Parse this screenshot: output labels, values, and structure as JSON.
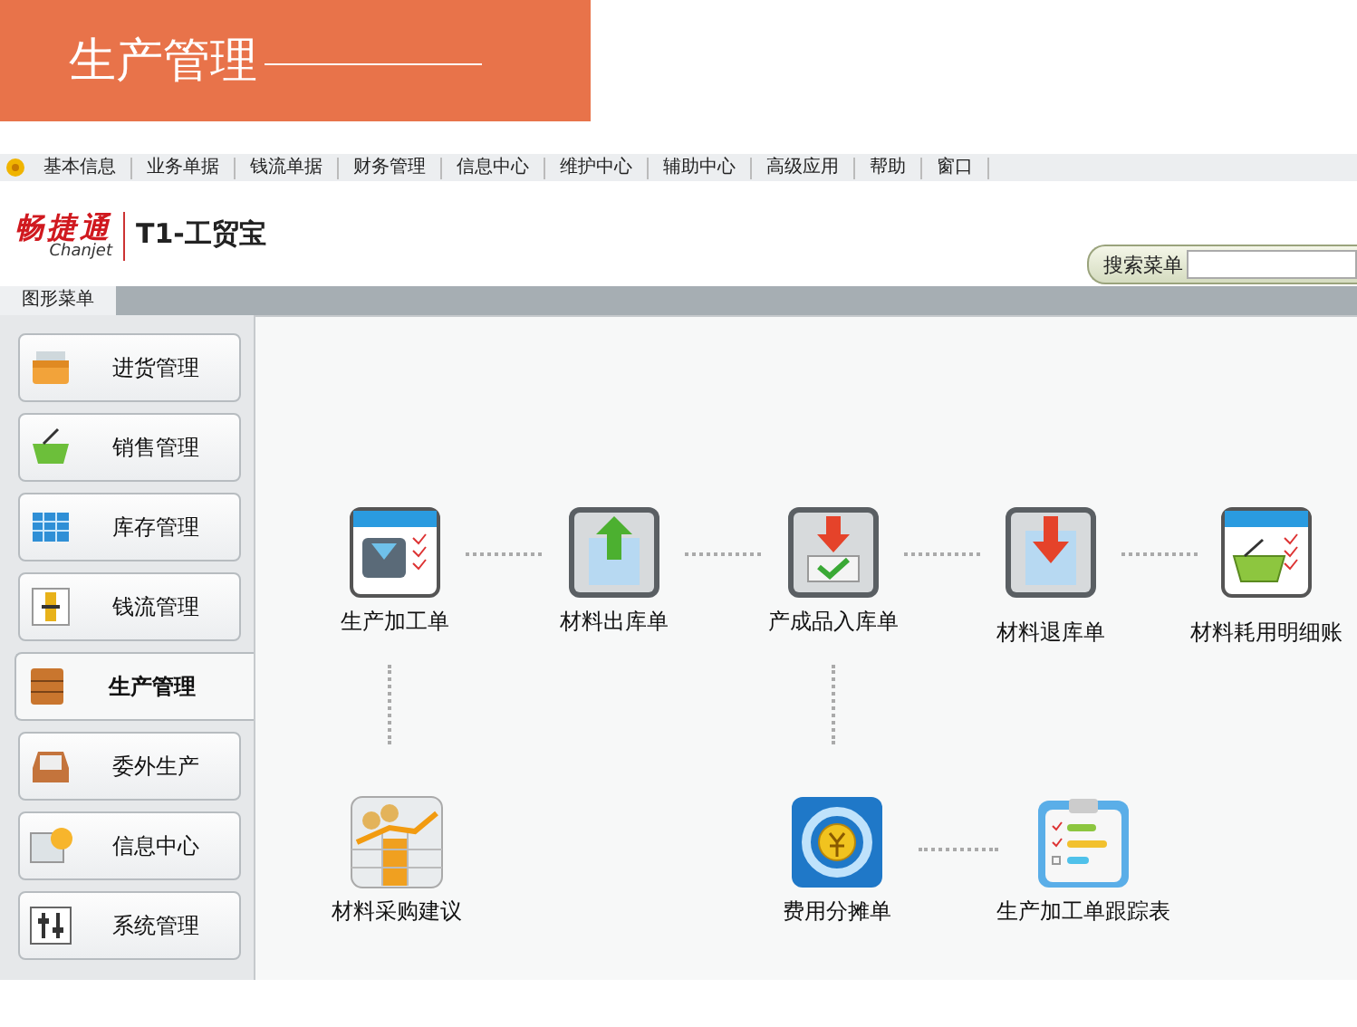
{
  "banner": {
    "title": "生产管理"
  },
  "menu_bar": {
    "items": [
      "基本信息",
      "业务单据",
      "钱流单据",
      "财务管理",
      "信息中心",
      "维护中心",
      "辅助中心",
      "高级应用",
      "帮助",
      "窗口"
    ]
  },
  "logo": {
    "brand": "畅捷通",
    "brand_latin": "Chanjet",
    "product": "T1-工贸宝"
  },
  "search": {
    "label": "搜索菜单"
  },
  "tabs": [
    {
      "label": "图形菜单",
      "selected": true
    }
  ],
  "sidebar": {
    "items": [
      {
        "label": "进货管理",
        "kind": "purchase",
        "selected": false
      },
      {
        "label": "销售管理",
        "kind": "basket",
        "selected": false
      },
      {
        "label": "库存管理",
        "kind": "stock",
        "selected": false
      },
      {
        "label": "钱流管理",
        "kind": "money",
        "selected": false
      },
      {
        "label": "生产管理",
        "kind": "cabinet",
        "selected": true
      },
      {
        "label": "委外生产",
        "kind": "tray",
        "selected": false
      },
      {
        "label": "信息中心",
        "kind": "bulb",
        "selected": false
      },
      {
        "label": "系统管理",
        "kind": "sliders",
        "selected": false
      }
    ]
  },
  "flow": {
    "nodes": [
      {
        "label": "生产加工单",
        "kind": "doc-machine"
      },
      {
        "label": "材料出库单",
        "kind": "box-up"
      },
      {
        "label": "产成品入库单",
        "kind": "box-check"
      },
      {
        "label": "材料退库单",
        "kind": "box-down"
      },
      {
        "label": "材料耗用明细账",
        "kind": "doc-basket"
      },
      {
        "label": "材料采购建议",
        "kind": "sheet-chart"
      },
      {
        "label": "费用分摊单",
        "kind": "coin-cycle"
      },
      {
        "label": "生产加工单跟踪表",
        "kind": "checklist"
      }
    ]
  }
}
